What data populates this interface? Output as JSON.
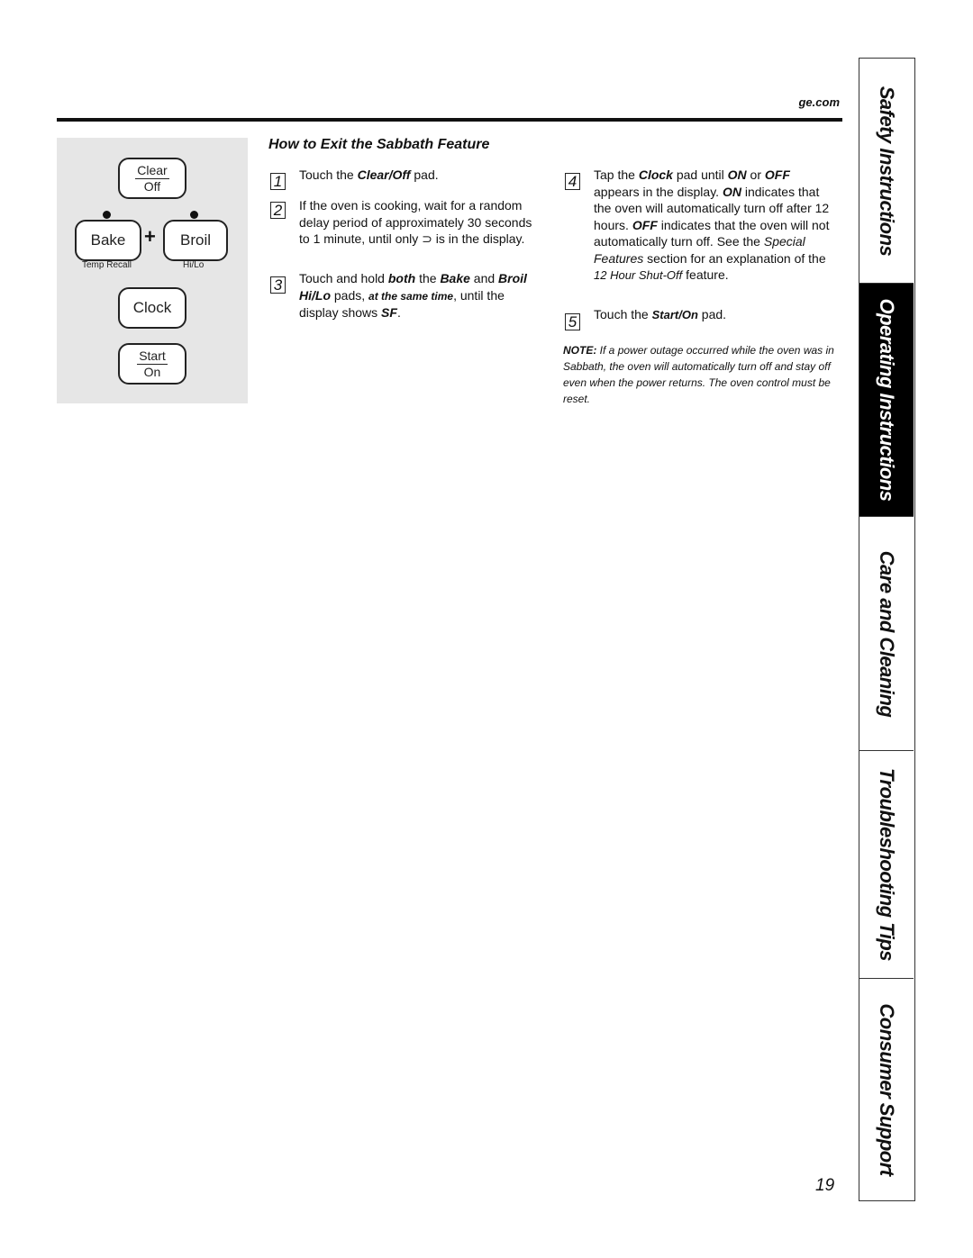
{
  "header": {
    "site": "ge.com"
  },
  "control_panel": {
    "clear_off": {
      "top": "Clear",
      "bottom": "Off"
    },
    "bake": {
      "label": "Bake",
      "sub": "Temp Recall"
    },
    "plus": "+",
    "broil": {
      "label": "Broil",
      "sub": "Hi/Lo"
    },
    "clock": {
      "label": "Clock"
    },
    "start_on": {
      "top": "Start",
      "bottom": "On"
    }
  },
  "section": {
    "title": "How to Exit the Sabbath Feature",
    "steps": [
      {
        "n": "1",
        "parts": [
          "Touch the ",
          "Clear/Off",
          " pad."
        ]
      },
      {
        "n": "2",
        "text": "If the oven is cooking, wait for a random delay period of approximately 30 seconds to 1 minute, until only ⊃ is in the display."
      },
      {
        "n": "3",
        "parts": [
          "Touch and hold ",
          "both",
          " the ",
          "Bake",
          " and ",
          "Broil Hi/Lo",
          " pads, ",
          "at the same time",
          ", until the display shows ",
          "SF",
          "."
        ]
      },
      {
        "n": "4",
        "parts": [
          "Tap the ",
          "Clock",
          " pad until ",
          "ON",
          " or ",
          "OFF",
          " appears in the display. ",
          "ON",
          " indicates that the oven will automatically turn off after 12 hours. ",
          "OFF",
          " indicates that the oven will not automatically turn off. See the ",
          "Special Features",
          " section for an explanation of the ",
          "12 Hour Shut-Off",
          " feature."
        ]
      },
      {
        "n": "5",
        "parts": [
          "Touch the ",
          "Start/On",
          " pad."
        ]
      }
    ],
    "note": {
      "label": "NOTE:",
      "text": " If a power outage occurred while the oven was in Sabbath, the oven will automatically turn off and stay off even when the power returns. The oven control must be reset."
    }
  },
  "tabs": [
    {
      "label": "Safety Instructions",
      "active": false
    },
    {
      "label": "Operating Instructions",
      "active": true
    },
    {
      "label": "Care and Cleaning",
      "active": false
    },
    {
      "label": "Troubleshooting Tips",
      "active": false
    },
    {
      "label": "Consumer Support",
      "active": false
    }
  ],
  "page_number": "19"
}
